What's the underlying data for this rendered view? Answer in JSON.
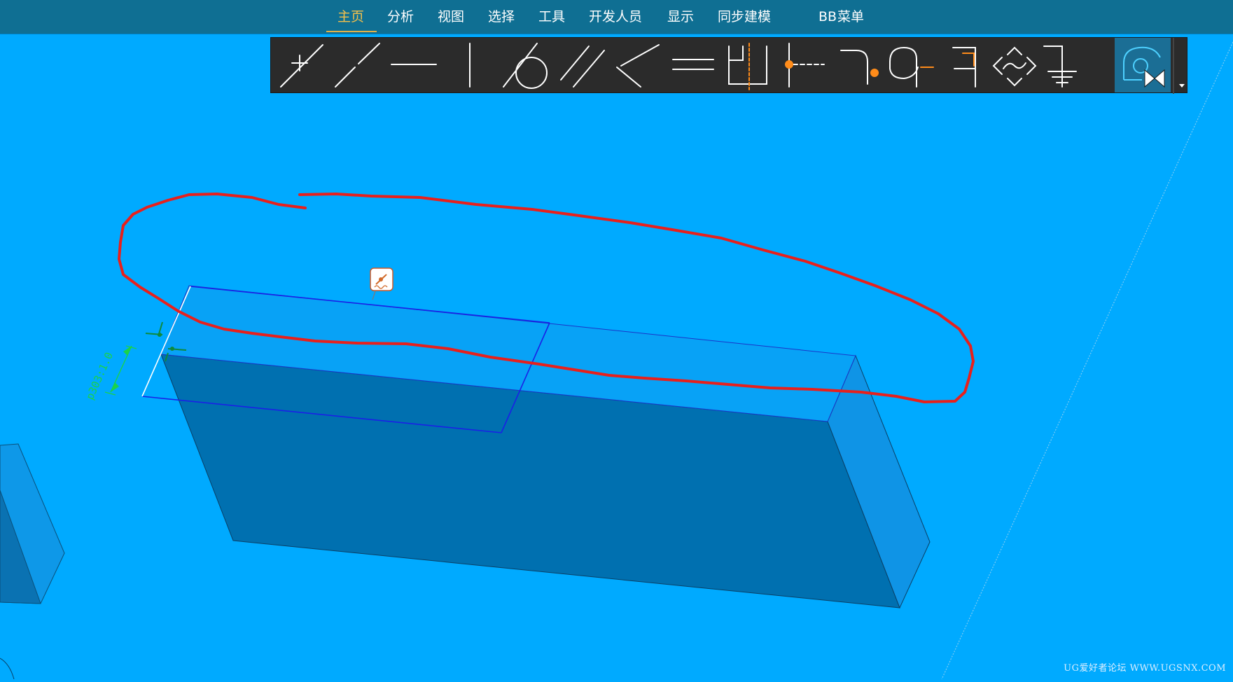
{
  "menubar": {
    "tabs": [
      {
        "label": "主页",
        "active": true
      },
      {
        "label": "分析"
      },
      {
        "label": "视图"
      },
      {
        "label": "选择"
      },
      {
        "label": "工具"
      },
      {
        "label": "开发人员"
      },
      {
        "label": "显示"
      },
      {
        "label": "同步建模"
      },
      {
        "label": "BB"
      },
      {
        "label": "菜单"
      }
    ],
    "active_color": "#f5c04a",
    "background": "#0f6f93"
  },
  "toolbar": {
    "tools": [
      "perpendicular-constraint-icon",
      "collinear-icon",
      "horizontal-icon",
      "vertical-icon",
      "tangent-icon",
      "parallel-icon",
      "angle-icon",
      "equal-length-icon",
      "symmetric-icon",
      "point-on-curve-icon",
      "fixed-end-icon",
      "concentric-icon",
      "offset-icon",
      "wave-sketch-icon",
      "ground-icon",
      "active-sketch-constraint-icon"
    ],
    "overflow_icon": "dropdown-arrow-icon"
  },
  "viewport": {
    "background": "#00aaff",
    "dimension_label": "p303:1.0",
    "annotation_color": "#ff2020",
    "watermark": "UG爱好者论坛 WWW.UGSNX.COM"
  }
}
